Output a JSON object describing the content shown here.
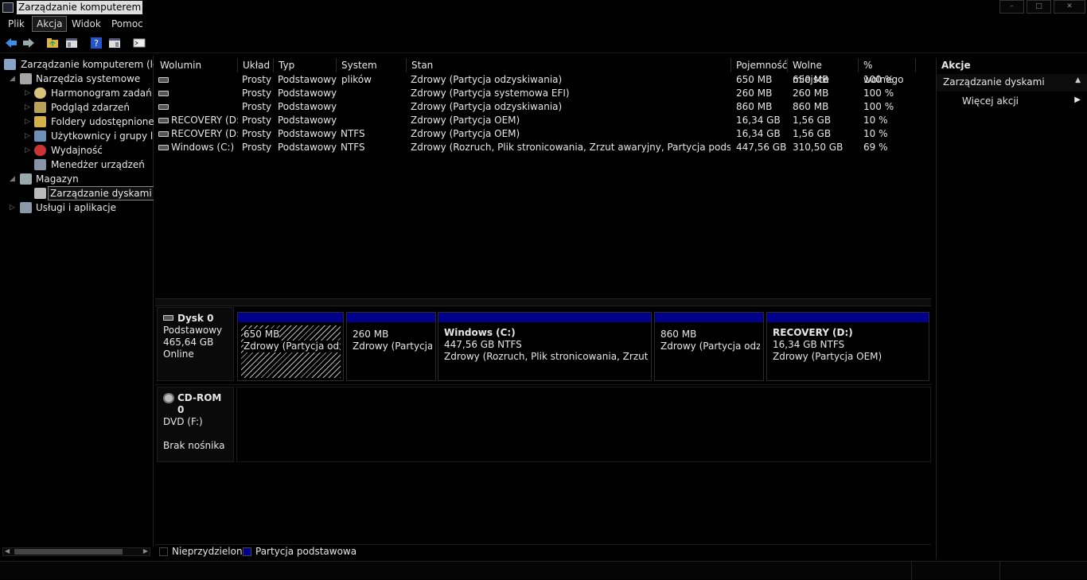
{
  "window": {
    "title": "Zarządzanie komputerem",
    "buttons": {
      "minimize": "–",
      "maximize": "□",
      "close": "✕"
    }
  },
  "menu": [
    "Plik",
    "Akcja",
    "Widok",
    "Pomoc"
  ],
  "toolbar": {
    "icons": [
      "back-arrow-icon",
      "forward-arrow-icon",
      "up-folder-icon",
      "show-hide-tree-icon",
      "help-icon",
      "properties-icon",
      "console-icon"
    ]
  },
  "tree": {
    "root": "Zarządzanie komputerem (lokalny)",
    "system_tools": "Narzędzia systemowe",
    "task_scheduler": "Harmonogram zadań",
    "event_viewer": "Podgląd zdarzeń",
    "shared_folders": "Foldery udostępnione",
    "local_users": "Użytkownicy i grupy lokalne",
    "performance": "Wydajność",
    "device_manager": "Menedżer urządzeń",
    "storage": "Magazyn",
    "disk_management": "Zarządzanie dyskami",
    "services": "Usługi i aplikacje"
  },
  "columns": [
    "Wolumin",
    "Układ",
    "Typ",
    "System plików",
    "Stan",
    "Pojemność",
    "Wolne miejsce",
    "% wolnego"
  ],
  "volumes": [
    {
      "name": "",
      "layout": "Prosty",
      "type": "Podstawowy",
      "fs": "",
      "status": "Zdrowy (Partycja odzyskiwania)",
      "capacity": "650 MB",
      "free": "650 MB",
      "pct": "100 %"
    },
    {
      "name": "",
      "layout": "Prosty",
      "type": "Podstawowy",
      "fs": "",
      "status": "Zdrowy (Partycja systemowa EFI)",
      "capacity": "260 MB",
      "free": "260 MB",
      "pct": "100 %"
    },
    {
      "name": "",
      "layout": "Prosty",
      "type": "Podstawowy",
      "fs": "",
      "status": "Zdrowy (Partycja odzyskiwania)",
      "capacity": "860 MB",
      "free": "860 MB",
      "pct": "100 %"
    },
    {
      "name": "RECOVERY (D:)",
      "layout": "Prosty",
      "type": "Podstawowy",
      "fs": "",
      "status": "Zdrowy (Partycja OEM)",
      "capacity": "16,34 GB",
      "free": "1,56 GB",
      "pct": "10 %"
    },
    {
      "name": "RECOVERY (D:)",
      "layout": "Prosty",
      "type": "Podstawowy",
      "fs": "NTFS",
      "status": "Zdrowy (Partycja OEM)",
      "capacity": "16,34 GB",
      "free": "1,56 GB",
      "pct": "10 %"
    },
    {
      "name": "Windows (C:)",
      "layout": "Prosty",
      "type": "Podstawowy",
      "fs": "NTFS",
      "status": "Zdrowy (Rozruch, Plik stronicowania, Zrzut awaryjny, Partycja podstawowa)",
      "capacity": "447,56 GB",
      "free": "310,50 GB",
      "pct": "69 %"
    }
  ],
  "disk0": {
    "name": "Dysk 0",
    "type": "Podstawowy",
    "size": "465,64 GB",
    "state": "Online",
    "partitions": [
      {
        "title": "",
        "size": "650 MB",
        "status": "Zdrowy (Partycja odzyskiwania)"
      },
      {
        "title": "",
        "size": "260 MB",
        "status": "Zdrowy (Partycja systemowa EFI)"
      },
      {
        "title": "Windows  (C:)",
        "size": "447,56 GB NTFS",
        "status": "Zdrowy (Rozruch, Plik stronicowania, Zrzut awaryjny, Partycja podstawowa)"
      },
      {
        "title": "",
        "size": "860 MB",
        "status": "Zdrowy (Partycja odzyskiwania)"
      },
      {
        "title": "RECOVERY  (D:)",
        "size": "16,34 GB NTFS",
        "status": "Zdrowy (Partycja OEM)"
      }
    ]
  },
  "cdrom0": {
    "name": "CD-ROM 0",
    "drive": "DVD (F:)",
    "media": "Brak nośnika"
  },
  "legend": {
    "unallocated": "Nieprzydzielone",
    "primary": "Partycja podstawowa"
  },
  "actions": {
    "header": "Akcje",
    "section": "Zarządzanie dyskami",
    "more": "Więcej akcji"
  },
  "colors": {
    "partition_bar": "#00008b",
    "background": "#000000"
  }
}
